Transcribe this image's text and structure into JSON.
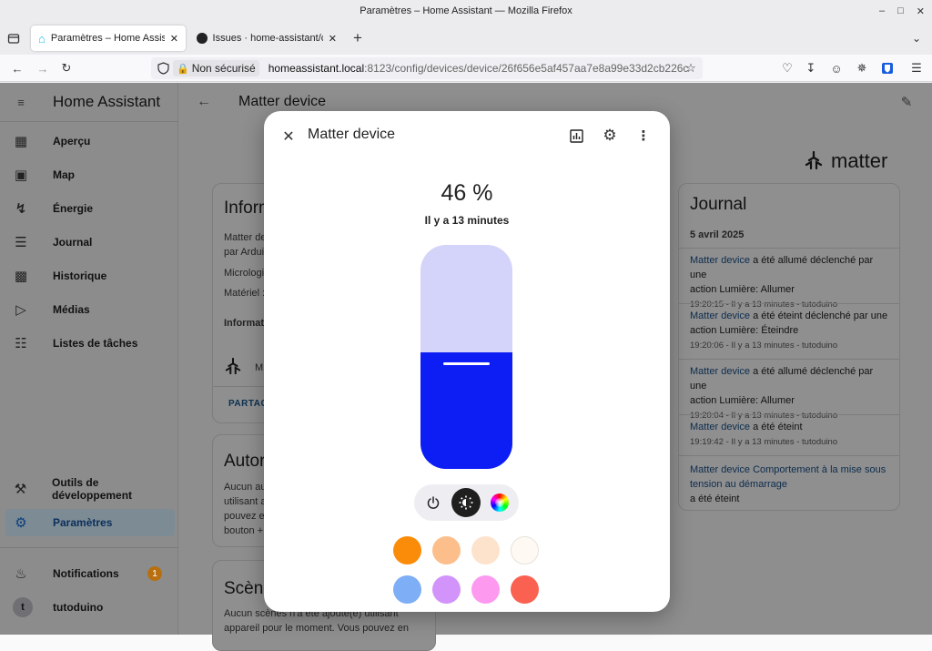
{
  "browser": {
    "window_title": "Paramètres – Home Assistant — Mozilla Firefox",
    "tabs": [
      {
        "label": "Paramètres – Home Assistant"
      },
      {
        "label": "Issues · home-assistant/core"
      }
    ],
    "security_label": "Non sécurisé",
    "url_host": "homeassistant.local",
    "url_rest": ":8123/config/devices/device/26f656e5af457aa7e8a99e33d2cb226c"
  },
  "sidebar": {
    "title": "Home Assistant",
    "items": [
      {
        "label": "Aperçu",
        "icon": "dashboard-icon"
      },
      {
        "label": "Map",
        "icon": "map-icon"
      },
      {
        "label": "Énergie",
        "icon": "lightning-icon"
      },
      {
        "label": "Journal",
        "icon": "list-icon"
      },
      {
        "label": "Historique",
        "icon": "chart-icon"
      },
      {
        "label": "Médias",
        "icon": "play-icon"
      },
      {
        "label": "Listes de tâches",
        "icon": "clipboard-icon"
      }
    ],
    "dev_tools": "Outils de développement",
    "settings": "Paramètres",
    "notifications": "Notifications",
    "notifications_count": "1",
    "user": "tutoduino",
    "user_initial": "t"
  },
  "page": {
    "title": "Matter device",
    "matter_logo": "matter",
    "info_card": {
      "title": "Inform",
      "line1": "Matter de",
      "line2": "par Ardui",
      "line3": "Micrologi",
      "line4": "Matériel :",
      "line5": "Informati",
      "integration": "M",
      "share": "PARTAG"
    },
    "auto_card": {
      "title": "Autor",
      "lines": [
        "Aucun au",
        "utilisant a",
        "pouvez en",
        "bouton +"
      ]
    },
    "scene_card": {
      "title": "Scène",
      "lines": [
        "Aucun scènes n'a été ajouté(e) utilisant",
        "appareil pour le moment. Vous pouvez en"
      ]
    },
    "journal": {
      "title": "Journal",
      "date": "5 avril 2025",
      "entries": [
        {
          "link": "Matter device",
          "text1": " a été allumé déclenché par une",
          "text2": "action Lumière: Allumer",
          "meta": "19:20:15 - Il y a 13 minutes - tutoduino"
        },
        {
          "link": "Matter device",
          "text1": " a été éteint déclenché par une",
          "text2": "action Lumière: Éteindre",
          "meta": "19:20:06 - Il y a 13 minutes - tutoduino"
        },
        {
          "link": "Matter device",
          "text1": " a été allumé déclenché par une",
          "text2": "action Lumière: Allumer",
          "meta": "19:20:04 - Il y a 13 minutes - tutoduino"
        },
        {
          "link": "Matter device",
          "text1": " a été éteint",
          "text2": "",
          "meta": "19:19:42 - Il y a 13 minutes - tutoduino"
        },
        {
          "link": "Matter device Comportement à la mise sous",
          "text1": "",
          "text2": "tension au démarrage",
          "meta": "a été éteint"
        }
      ]
    }
  },
  "dialog": {
    "title": "Matter device",
    "brightness": "46 %",
    "brightness_level": 0.52,
    "last_changed": "Il y a 13 minutes",
    "colors": {
      "slider_track": "#d4d4fa",
      "slider_fill": "#0d1ef5"
    },
    "swatches": [
      "#fb8c0a",
      "#fcbf8b",
      "#fde3cb",
      "#fefaf3",
      "#7eaef5",
      "#d293fa",
      "#fd9af0",
      "#fa6151"
    ]
  }
}
